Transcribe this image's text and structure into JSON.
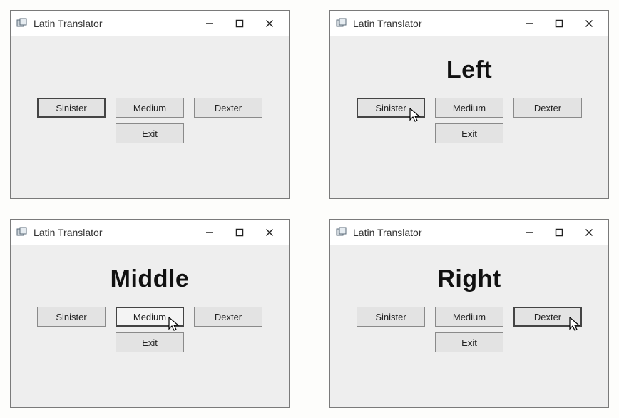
{
  "windows": [
    {
      "title": "Latin Translator",
      "translation": "",
      "buttons": {
        "sinister": "Sinister",
        "medium": "Medium",
        "dexter": "Dexter",
        "exit": "Exit"
      },
      "active_button": "sinister",
      "cursor_on": null
    },
    {
      "title": "Latin Translator",
      "translation": "Left",
      "buttons": {
        "sinister": "Sinister",
        "medium": "Medium",
        "dexter": "Dexter",
        "exit": "Exit"
      },
      "active_button": "sinister",
      "cursor_on": "sinister"
    },
    {
      "title": "Latin Translator",
      "translation": "Middle",
      "buttons": {
        "sinister": "Sinister",
        "medium": "Medium",
        "dexter": "Dexter",
        "exit": "Exit"
      },
      "active_button": "medium",
      "cursor_on": "medium"
    },
    {
      "title": "Latin Translator",
      "translation": "Right",
      "buttons": {
        "sinister": "Sinister",
        "medium": "Medium",
        "dexter": "Dexter",
        "exit": "Exit"
      },
      "active_button": "dexter",
      "cursor_on": "dexter"
    }
  ]
}
